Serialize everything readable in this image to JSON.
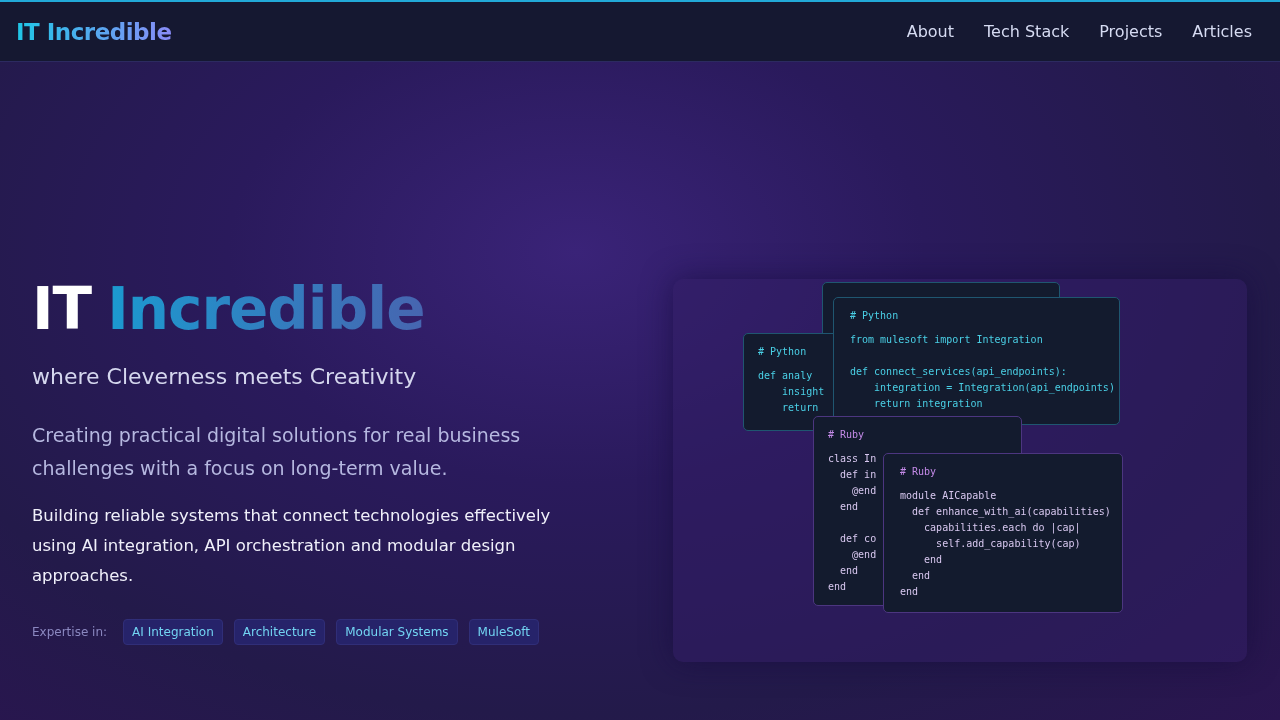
{
  "header": {
    "logo": "IT Incredible",
    "nav": [
      {
        "label": "About"
      },
      {
        "label": "Tech Stack"
      },
      {
        "label": "Projects"
      },
      {
        "label": "Articles"
      }
    ]
  },
  "hero": {
    "title_plain": "IT",
    "title_accent": "Incredible",
    "subtitle": "where Cleverness meets Creativity",
    "description": "Creating practical digital solutions for real business challenges with a focus on long-term value.",
    "body": "Building reliable systems that connect technologies effectively using AI integration, API orchestration and modular design approaches.",
    "expertise_label": "Expertise in:",
    "tags": [
      "AI Integration",
      "Architecture",
      "Modular Systems",
      "MuleSoft"
    ]
  },
  "code_cards": [
    {
      "kind": "python"
    },
    {
      "kind": "python",
      "heading": "# Python",
      "blocks": [
        [
          "def analy",
          "    insight",
          "    return"
        ]
      ]
    },
    {
      "kind": "python",
      "heading": "# Python",
      "blocks": [
        [
          "from mulesoft import Integration"
        ],
        [
          "def connect_services(api_endpoints):",
          "    integration = Integration(api_endpoints)",
          "    return integration"
        ]
      ]
    },
    {
      "kind": "ruby",
      "heading": "# Ruby",
      "blocks": [
        [
          "class In",
          "  def in",
          "    @end",
          "  end"
        ],
        [
          "  def co",
          "    @end",
          "  end",
          "end"
        ]
      ]
    },
    {
      "kind": "ruby",
      "heading": "# Ruby",
      "blocks": [
        [
          "module AICapable",
          "  def enhance_with_ai(capabilities)",
          "    capabilities.each do |cap|",
          "      self.add_capability(cap)",
          "    end",
          "  end",
          "end"
        ]
      ]
    }
  ]
}
